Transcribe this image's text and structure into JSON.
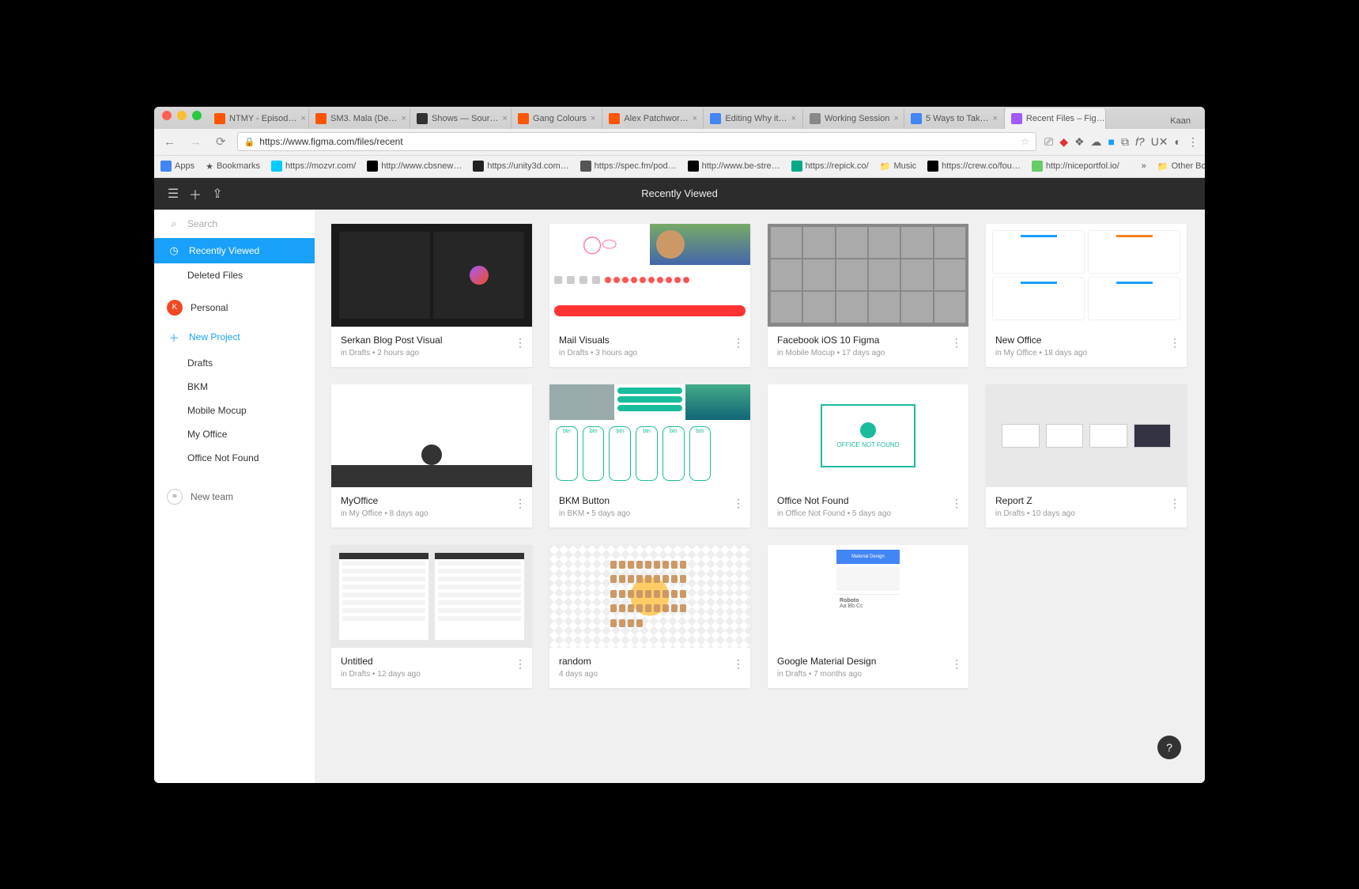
{
  "browser": {
    "user": "Kaan",
    "tabs": [
      {
        "label": "NTMY - Episod…",
        "fav": "fv-sc"
      },
      {
        "label": "SM3. Mala (De…",
        "fav": "fv-sc"
      },
      {
        "label": "Shows — Sour…",
        "fav": "fv-f"
      },
      {
        "label": "Gang Colours",
        "fav": "fv-sc"
      },
      {
        "label": "Alex Patchwor…",
        "fav": "fv-sc"
      },
      {
        "label": "Editing Why it…",
        "fav": "fv-g"
      },
      {
        "label": "Working Session",
        "fav": "fv-d"
      },
      {
        "label": "5 Ways to Tak…",
        "fav": "fv-g"
      },
      {
        "label": "Recent Files – Fig…",
        "fav": "fv-fm",
        "active": true
      }
    ],
    "url": "https://www.figma.com/files/recent",
    "bookmarks": [
      "Apps",
      "Bookmarks",
      "https://mozvr.com/",
      "http://www.cbsnew…",
      "https://unity3d.com…",
      "https://spec.fm/pod…",
      "http://www.be-stre…",
      "https://repick.co/",
      "Music",
      "https://crew.co/fou…",
      "http://niceportfol.io/"
    ],
    "other_bookmarks": "Other Bookmarks"
  },
  "app": {
    "header_title": "Recently Viewed",
    "search_placeholder": "Search",
    "sidebar": {
      "recently_viewed": "Recently Viewed",
      "deleted_files": "Deleted Files",
      "personal": "Personal",
      "new_project": "New Project",
      "projects": [
        "Drafts",
        "BKM",
        "Mobile Mocup",
        "My Office",
        "Office Not Found"
      ],
      "new_team": "New team",
      "avatar_letter": "K"
    },
    "files": [
      {
        "title": "Serkan Blog Post Visual",
        "sub": "in Drafts  •  2 hours ago",
        "thumb": "dark"
      },
      {
        "title": "Mail Visuals",
        "sub": "in Drafts  •  3 hours ago",
        "thumb": "mail"
      },
      {
        "title": "Facebook iOS 10 Figma",
        "sub": "in Mobile Mocup  •  17 days ago",
        "thumb": "grid"
      },
      {
        "title": "New Office",
        "sub": "in My Office  •  18 days ago",
        "thumb": "office"
      },
      {
        "title": "MyOffice",
        "sub": "in My Office  •  8 days ago",
        "thumb": "stick"
      },
      {
        "title": "BKM Button",
        "sub": "in BKM  •  5 days ago",
        "thumb": "bkm"
      },
      {
        "title": "Office Not Found",
        "sub": "in Office Not Found  •  5 days ago",
        "thumb": "onf"
      },
      {
        "title": "Report Z",
        "sub": "in Drafts  •  10 days ago",
        "thumb": "rz"
      },
      {
        "title": "Untitled",
        "sub": "in Drafts  •  12 days ago",
        "thumb": "unt"
      },
      {
        "title": "random",
        "sub": "4 days ago",
        "thumb": "rand"
      },
      {
        "title": "Google Material Design",
        "sub": "in Drafts  •  7 months ago",
        "thumb": "mat"
      }
    ],
    "help": "?"
  }
}
